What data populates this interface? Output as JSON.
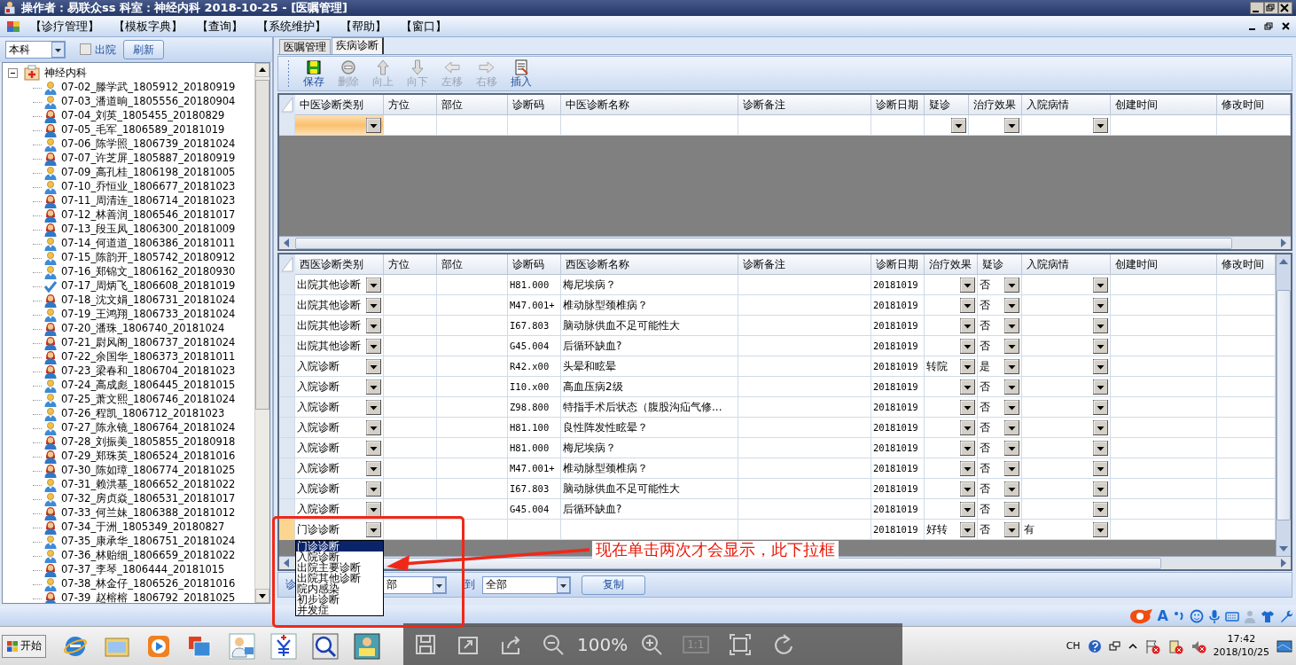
{
  "window": {
    "title": "操作者：易联众ss  科室：神经内科  2018-10-25 - [医嘱管理]"
  },
  "menu": [
    "【诊疗管理】",
    "【模板字典】",
    "【查询】",
    "【系统维护】",
    "【帮助】",
    "【窗口】"
  ],
  "left_panel": {
    "scope_select": "本科",
    "discharged_checkbox": {
      "label": "出院",
      "checked": false
    },
    "refresh_button": "刷新",
    "tree": {
      "label": "神经内科",
      "expanded": true,
      "children": [
        {
          "label": "07-02_滕学武_1805912_20180919",
          "kind": "male"
        },
        {
          "label": "07-03_潘道晌_1805556_20180904",
          "kind": "male"
        },
        {
          "label": "07-04_刘英_1805455_20180829",
          "kind": "female"
        },
        {
          "label": "07-05_毛军_1806589_20181019",
          "kind": "female"
        },
        {
          "label": "07-06_陈学照_1806739_20181024",
          "kind": "male"
        },
        {
          "label": "07-07_许芝屏_1805887_20180919",
          "kind": "female"
        },
        {
          "label": "07-09_高孔桂_1806198_20181005",
          "kind": "male"
        },
        {
          "label": "07-10_乔恒业_1806677_20181023",
          "kind": "male"
        },
        {
          "label": "07-11_周清连_1806714_20181023",
          "kind": "female"
        },
        {
          "label": "07-12_林善润_1806546_20181017",
          "kind": "female"
        },
        {
          "label": "07-13_段玉凤_1806300_20181009",
          "kind": "female"
        },
        {
          "label": "07-14_何道道_1806386_20181011",
          "kind": "male"
        },
        {
          "label": "07-15_陈韵开_1805742_20180912",
          "kind": "male"
        },
        {
          "label": "07-16_郑锦文_1806162_20180930",
          "kind": "male"
        },
        {
          "label": "07-17_周炳飞_1806608_20181019",
          "kind": "checked"
        },
        {
          "label": "07-18_沈文娟_1806731_20181024",
          "kind": "female"
        },
        {
          "label": "07-19_王鸿翔_1806733_20181024",
          "kind": "male"
        },
        {
          "label": "07-20_潘珠_1806740_20181024",
          "kind": "female"
        },
        {
          "label": "07-21_尉风阁_1806737_20181024",
          "kind": "female"
        },
        {
          "label": "07-22_余国华_1806373_20181011",
          "kind": "female"
        },
        {
          "label": "07-23_梁春和_1806704_20181023",
          "kind": "female"
        },
        {
          "label": "07-24_高成彪_1806445_20181015",
          "kind": "male"
        },
        {
          "label": "07-25_萧文熙_1806746_20181024",
          "kind": "male"
        },
        {
          "label": "07-26_程凯_1806712_20181023",
          "kind": "male"
        },
        {
          "label": "07-27_陈永镜_1806764_20181024",
          "kind": "male"
        },
        {
          "label": "07-28_刘振美_1805855_20180918",
          "kind": "female"
        },
        {
          "label": "07-29_郑珠英_1806524_20181016",
          "kind": "female"
        },
        {
          "label": "07-30_陈如璋_1806774_20181025",
          "kind": "female"
        },
        {
          "label": "07-31_赖洪基_1806652_20181022",
          "kind": "male"
        },
        {
          "label": "07-32_房贞焱_1806531_20181017",
          "kind": "male"
        },
        {
          "label": "07-33_何兰妹_1806388_20181012",
          "kind": "female"
        },
        {
          "label": "07-34_于洲_1805349_20180827",
          "kind": "female"
        },
        {
          "label": "07-35_康承华_1806751_20181024",
          "kind": "male"
        },
        {
          "label": "07-36_林贻细_1806659_20181022",
          "kind": "male"
        },
        {
          "label": "07-37_李琴_1806444_20181015",
          "kind": "female"
        },
        {
          "label": "07-38_林金仔_1806526_20181016",
          "kind": "male"
        },
        {
          "label": "07-39_赵榕榕_1806792_20181025",
          "kind": "female"
        }
      ]
    }
  },
  "tabs": [
    {
      "label": "医嘱管理",
      "selected": false
    },
    {
      "label": "疾病诊断",
      "selected": true
    }
  ],
  "toolbar": [
    {
      "label": "保存",
      "kind": "save",
      "disabled": false
    },
    {
      "label": "删除",
      "kind": "delete",
      "disabled": true
    },
    {
      "label": "向上",
      "kind": "up",
      "disabled": true
    },
    {
      "label": "向下",
      "kind": "down",
      "disabled": true
    },
    {
      "label": "左移",
      "kind": "left",
      "disabled": true
    },
    {
      "label": "右移",
      "kind": "right",
      "disabled": true
    },
    {
      "label": "插入",
      "kind": "insert",
      "disabled": false
    }
  ],
  "tcm_grid": {
    "columns": [
      {
        "label": "中医诊断类别",
        "kind": "combo"
      },
      {
        "label": "方位",
        "kind": "text"
      },
      {
        "label": "部位",
        "kind": "text"
      },
      {
        "label": "诊断码",
        "kind": "text"
      },
      {
        "label": "中医诊断名称",
        "kind": "text"
      },
      {
        "label": "诊断备注",
        "kind": "text"
      },
      {
        "label": "诊断日期",
        "kind": "text"
      },
      {
        "label": "疑诊",
        "kind": "combo"
      },
      {
        "label": "治疗效果",
        "kind": "combo"
      },
      {
        "label": "入院病情",
        "kind": "combo"
      },
      {
        "label": "创建时间",
        "kind": "text"
      },
      {
        "label": "修改时间",
        "kind": "text"
      }
    ],
    "rows": [
      {
        "selected": false,
        "editing": true,
        "cells": [
          null,
          null,
          null,
          null,
          null,
          null,
          null,
          null,
          null,
          null,
          null,
          null
        ]
      }
    ]
  },
  "wm_grid": {
    "columns": [
      {
        "label": "西医诊断类别",
        "kind": "combo"
      },
      {
        "label": "方位",
        "kind": "text"
      },
      {
        "label": "部位",
        "kind": "text"
      },
      {
        "label": "诊断码",
        "kind": "text"
      },
      {
        "label": "西医诊断名称",
        "kind": "text"
      },
      {
        "label": "诊断备注",
        "kind": "text"
      },
      {
        "label": "诊断日期",
        "kind": "text"
      },
      {
        "label": "治疗效果",
        "kind": "combo"
      },
      {
        "label": "疑诊",
        "kind": "combo"
      },
      {
        "label": "入院病情",
        "kind": "combo"
      },
      {
        "label": "创建时间",
        "kind": "text"
      },
      {
        "label": "修改时间",
        "kind": "text"
      }
    ],
    "rows": [
      {
        "selected": false,
        "editing": false,
        "cells": [
          "出院其他诊断",
          null,
          null,
          "H81.000",
          "梅尼埃病？",
          null,
          "20181019",
          null,
          "否",
          null,
          null,
          null
        ]
      },
      {
        "selected": false,
        "editing": false,
        "cells": [
          "出院其他诊断",
          null,
          null,
          "M47.001+",
          "椎动脉型颈椎病？",
          null,
          "20181019",
          null,
          "否",
          null,
          null,
          null
        ]
      },
      {
        "selected": false,
        "editing": false,
        "cells": [
          "出院其他诊断",
          null,
          null,
          "I67.803",
          "脑动脉供血不足可能性大",
          null,
          "20181019",
          null,
          "否",
          null,
          null,
          null
        ]
      },
      {
        "selected": false,
        "editing": false,
        "cells": [
          "出院其他诊断",
          null,
          null,
          "G45.004",
          "后循环缺血?",
          null,
          "20181019",
          null,
          "否",
          null,
          null,
          null
        ]
      },
      {
        "selected": false,
        "editing": false,
        "cells": [
          "入院诊断",
          null,
          null,
          "R42.x00",
          "头晕和眩晕",
          null,
          "20181019",
          "转院",
          "是",
          null,
          null,
          null
        ]
      },
      {
        "selected": false,
        "editing": false,
        "cells": [
          "入院诊断",
          null,
          null,
          "I10.x00",
          "高血压病2级",
          null,
          "20181019",
          null,
          "否",
          null,
          null,
          null
        ]
      },
      {
        "selected": false,
        "editing": false,
        "cells": [
          "入院诊断",
          null,
          null,
          "Z98.800",
          "特指手术后状态（腹股沟疝气修...",
          null,
          "20181019",
          null,
          "否",
          null,
          null,
          null
        ]
      },
      {
        "selected": false,
        "editing": false,
        "cells": [
          "入院诊断",
          null,
          null,
          "H81.100",
          "良性阵发性眩晕？",
          null,
          "20181019",
          null,
          "否",
          null,
          null,
          null
        ]
      },
      {
        "selected": false,
        "editing": false,
        "cells": [
          "入院诊断",
          null,
          null,
          "H81.000",
          "梅尼埃病？",
          null,
          "20181019",
          null,
          "否",
          null,
          null,
          null
        ]
      },
      {
        "selected": false,
        "editing": false,
        "cells": [
          "入院诊断",
          null,
          null,
          "M47.001+",
          "椎动脉型颈椎病？",
          null,
          "20181019",
          null,
          "否",
          null,
          null,
          null
        ]
      },
      {
        "selected": false,
        "editing": false,
        "cells": [
          "入院诊断",
          null,
          null,
          "I67.803",
          "脑动脉供血不足可能性大",
          null,
          "20181019",
          null,
          "否",
          null,
          null,
          null
        ]
      },
      {
        "selected": false,
        "editing": false,
        "cells": [
          "入院诊断",
          null,
          null,
          "G45.004",
          "后循环缺血?",
          null,
          "20181019",
          null,
          "否",
          null,
          null,
          null
        ]
      },
      {
        "selected": true,
        "editing": false,
        "cells": [
          "门诊诊断",
          null,
          null,
          null,
          null,
          null,
          "20181019",
          "好转",
          "否",
          "有",
          null,
          null
        ]
      }
    ]
  },
  "dropdown_list": {
    "options": [
      {
        "label": "门诊诊断",
        "selected": true
      },
      {
        "label": "入院诊断",
        "selected": false
      },
      {
        "label": "出院主要诊断",
        "selected": false
      },
      {
        "label": "出院其他诊断",
        "selected": false
      },
      {
        "label": "院内感染",
        "selected": false
      },
      {
        "label": "初步诊断",
        "selected": false
      },
      {
        "label": "并发症",
        "selected": false
      }
    ]
  },
  "copy_bar": {
    "range_label": "诊",
    "range_from": "部",
    "to_label": "到",
    "range_to": "全部",
    "copy_button": "复制"
  },
  "annotation": {
    "text": "现在单击两次才会显示，此下拉框"
  },
  "ime_bar": {
    "letter": "A"
  },
  "taskbar": {
    "start_button": "开始",
    "viewer_zoom": "100%",
    "viewer_actual_size": "1:1",
    "language": "CH",
    "time": "17:42",
    "date": "2018/10/25"
  }
}
